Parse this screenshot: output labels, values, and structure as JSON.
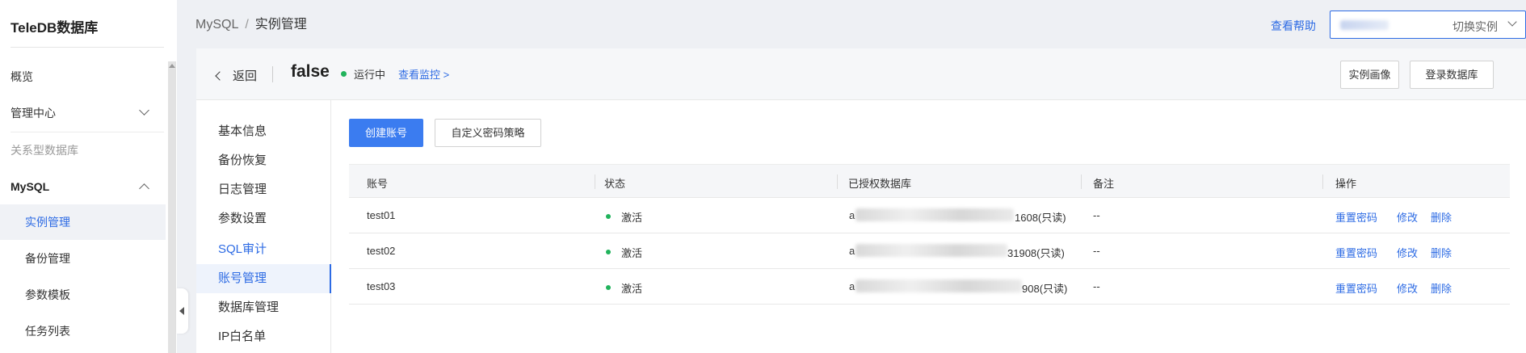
{
  "sidebar": {
    "logo": "TeleDB数据库",
    "items": {
      "overview": "概览",
      "management_center": "管理中心",
      "relational_db": "关系型数据库",
      "mysql": "MySQL",
      "instance_mgmt": "实例管理",
      "backup_mgmt": "备份管理",
      "param_template": "参数模板",
      "task_list": "任务列表"
    }
  },
  "header": {
    "breadcrumb": [
      "MySQL",
      "实例管理"
    ],
    "breadcrumb_sep": "/",
    "help": "查看帮助",
    "switch_instance": "切换实例"
  },
  "instance": {
    "back": "返回",
    "name": "false",
    "status": "运行中",
    "monitor_link": "查看监控 >",
    "buttons": [
      "实例画像",
      "登录数据库"
    ]
  },
  "submenu": [
    "基本信息",
    "备份恢复",
    "日志管理",
    "参数设置",
    "SQL审计",
    "账号管理",
    "数据库管理",
    "IP白名单"
  ],
  "actions": {
    "create_account": "创建账号",
    "custom_password_policy": "自定义密码策略"
  },
  "table": {
    "columns": [
      "账号",
      "状态",
      "已授权数据库",
      "备注",
      "操作"
    ],
    "rows": [
      {
        "account": "test01",
        "status": "激活",
        "db_prefix": "a",
        "db_suffix": "1608(只读)",
        "remark": "--"
      },
      {
        "account": "test02",
        "status": "激活",
        "db_prefix": "a",
        "db_suffix": "31908(只读)",
        "remark": "--"
      },
      {
        "account": "test03",
        "status": "激活",
        "db_prefix": "a",
        "db_suffix": "908(只读)",
        "remark": "--"
      }
    ],
    "row_actions": [
      "重置密码",
      "修改",
      "删除"
    ]
  },
  "colors": {
    "accent": "#2d6be4",
    "primary_button": "#3b7cf0",
    "status_active": "#21b35c"
  }
}
